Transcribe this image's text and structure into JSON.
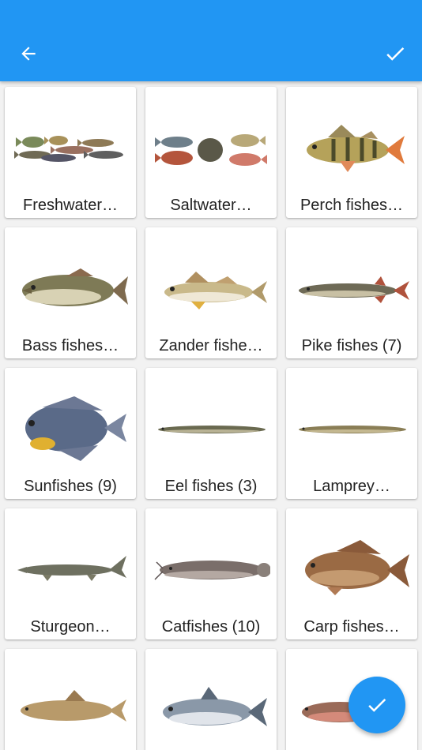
{
  "appbar": {
    "back_icon": "arrow-left-icon",
    "confirm_icon": "check-icon",
    "background": "#2196F3"
  },
  "categories": [
    {
      "label": "Freshwater…",
      "icon": "freshwater-fishes-image"
    },
    {
      "label": "Saltwater…",
      "icon": "saltwater-fishes-image"
    },
    {
      "label": "Perch fishes…",
      "icon": "perch-image"
    },
    {
      "label": "Bass fishes…",
      "icon": "bass-image"
    },
    {
      "label": "Zander fishe…",
      "icon": "zander-image"
    },
    {
      "label": "Pike fishes (7)",
      "icon": "pike-image"
    },
    {
      "label": "Sunfishes (9)",
      "icon": "sunfish-image"
    },
    {
      "label": "Eel fishes (3)",
      "icon": "eel-image"
    },
    {
      "label": "Lamprey…",
      "icon": "lamprey-image"
    },
    {
      "label": "Sturgeon…",
      "icon": "sturgeon-image"
    },
    {
      "label": "Catfishes (10)",
      "icon": "catfish-image"
    },
    {
      "label": "Carp fishes…",
      "icon": "carp-image"
    },
    {
      "label": "",
      "icon": "barbel-image"
    },
    {
      "label": "",
      "icon": "whitefish-image"
    },
    {
      "label": "",
      "icon": "trout-image"
    }
  ],
  "fab": {
    "icon": "check-icon",
    "color": "#2196F3"
  }
}
